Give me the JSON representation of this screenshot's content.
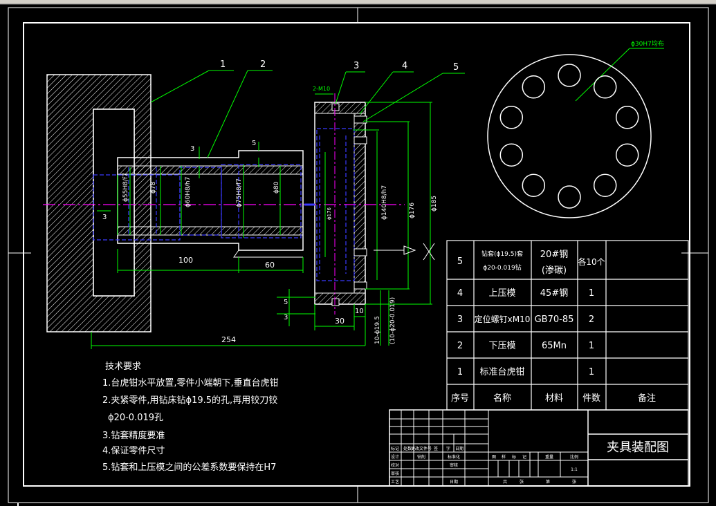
{
  "colors": {
    "background": "#000000",
    "frame": "#ffffff",
    "leader": "#00ff00",
    "hidden": "#3a3aff",
    "center": "#ff00ff",
    "table": "#ffffff"
  },
  "balloons": [
    "1",
    "2",
    "3",
    "4",
    "5"
  ],
  "dimensions": {
    "d3_left": "3",
    "d3_top": "3",
    "d5_top": "5",
    "d55": "ϕ55H8/f7",
    "d78": "ϕ78",
    "d60": "ϕ60H8/h7",
    "d75": "ϕ75H8/f7",
    "d80": "ϕ80",
    "d176_small": "ϕ176",
    "d140": "ϕ140H8/h7",
    "d176": "ϕ176",
    "d185": "ϕ185",
    "len100": "100",
    "len60": "60",
    "len30": "30",
    "len10": "10",
    "len254": "254",
    "d3_bottom": "3",
    "d5_bottom": "5",
    "hole_a": "10-ϕ19.5",
    "hole_b": "(10-ϕ20-0.019)",
    "m10": "2-M10",
    "pattern_label": "ϕ30H7均布"
  },
  "requirements": {
    "title": "技术要求",
    "line1": "1.台虎钳水平放置,零件小端朝下,垂直台虎钳",
    "line2": "2.夹紧零件,用钻床钻ϕ19.5的孔,再用铰刀铰",
    "line3": "ϕ20-0.019孔",
    "line4": "3.钻套精度要准",
    "line5": "4.保证零件尺寸",
    "line6": "5.钻套和上压模之间的公差系数要保持在H7"
  },
  "parts_table": {
    "header": {
      "no": "序号",
      "name": "名称",
      "material": "材料",
      "qty": "件数",
      "remark": "备注"
    },
    "rows": [
      {
        "no": "5",
        "name_a": "钻套(ϕ19.5)套",
        "name_b": "ϕ20-0.019钻",
        "material_a": "20#钢",
        "material_b": "(渗碳)",
        "qty": "各10个"
      },
      {
        "no": "4",
        "name": "上压模",
        "material": "45#钢",
        "qty": "1"
      },
      {
        "no": "3",
        "name": "定位螺钉xM10",
        "material": "GB70-85",
        "qty": "2"
      },
      {
        "no": "2",
        "name": "下压模",
        "material": "65Mn",
        "qty": "1"
      },
      {
        "no": "1",
        "name": "标准台虎钳",
        "material": "",
        "qty": "1"
      }
    ]
  },
  "title_block": {
    "drawing_title": "夹具装配图",
    "r1": [
      "标记",
      "处数",
      "更改文件号",
      "签",
      "字",
      "日期"
    ],
    "r2": [
      "设计",
      "钻削",
      "标准化"
    ],
    "r3": [
      "校对",
      "",
      "审核"
    ],
    "r4": [
      "审核",
      "",
      "工艺"
    ],
    "r5": [
      "工艺",
      "",
      "日期"
    ],
    "stage": [
      "图",
      "样",
      "标",
      "记"
    ],
    "weight": "重量",
    "scale": "比例",
    "scale_value": "1:1",
    "sheet": [
      "共",
      "张",
      "第",
      "张"
    ]
  }
}
